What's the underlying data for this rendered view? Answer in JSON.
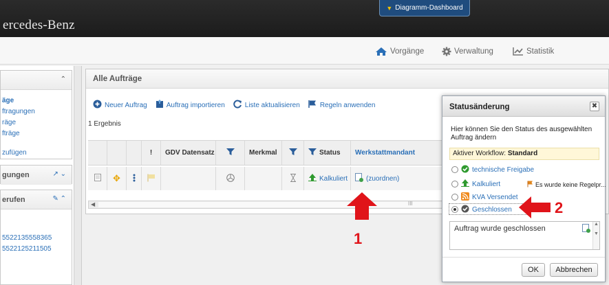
{
  "header": {
    "brand": "ercedes-Benz",
    "dashboard_tab": "Diagramm-Dashboard"
  },
  "nav": {
    "items": [
      {
        "label": "Vorgänge",
        "icon": "home-icon"
      },
      {
        "label": "Verwaltung",
        "icon": "gear-icon"
      },
      {
        "label": "Statistik",
        "icon": "chart-icon"
      }
    ]
  },
  "sidebar": {
    "panel1_links": [
      "äge",
      "ftragungen",
      "räge",
      "fträge"
    ],
    "panel1_add": "zufügen",
    "panel2_title": "gungen",
    "panel3_title": "erufen",
    "panel3_links": [
      "5522135558365",
      "5522125211505"
    ]
  },
  "main": {
    "title": "Alle Aufträge",
    "toolbar": {
      "new_order": "Neuer Auftrag",
      "import_order": "Auftrag importieren",
      "refresh": "Liste aktualisieren",
      "apply_rules": "Regeln anwenden"
    },
    "result_count": "1 Ergebnis",
    "columns": {
      "exclam": "!",
      "gdv": "GDV Datensatz",
      "merkmal": "Merkmal",
      "status": "Status",
      "werkstatt": "Werkstattmandant"
    },
    "row": {
      "status": "Kalkuliert",
      "werkstatt": "(zuordnen)"
    },
    "scroll_grip": "III"
  },
  "annotations": {
    "marker1": "1",
    "marker2": "2"
  },
  "dialog": {
    "title": "Statusänderung",
    "close": "✖",
    "description": "Hier können Sie den Status des ausgewählten Auftrag ändern",
    "workflow_label": "Aktiver Workflow:",
    "workflow_value": "Standard",
    "options": [
      {
        "label": "technische Freigabe",
        "selected": false
      },
      {
        "label": "Kalkuliert",
        "selected": false
      },
      {
        "label": "KVA Versendet",
        "selected": false
      },
      {
        "label": "Geschlossen",
        "selected": true
      }
    ],
    "note": "Es wurde keine Regelpr...",
    "textarea_value": "Auftrag wurde geschlossen",
    "ok": "OK",
    "cancel": "Abbrechen"
  },
  "colors": {
    "link": "#2a6fb7",
    "annotation_red": "#e0141a",
    "topbar": "#1c1c1c",
    "dashboard_tab": "#1f4c7e"
  }
}
